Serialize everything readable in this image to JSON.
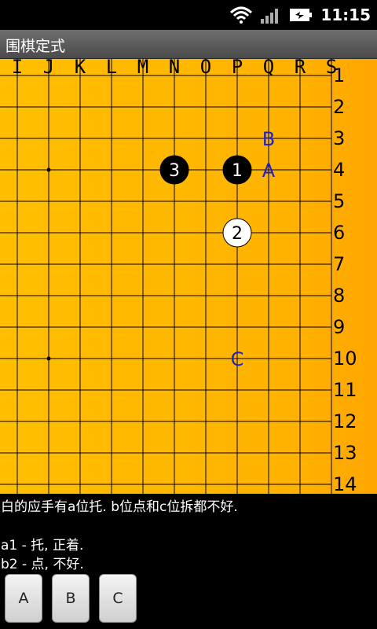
{
  "status_bar": {
    "time": "11:15"
  },
  "app": {
    "title": "围棋定式"
  },
  "board": {
    "col_labels": [
      "I",
      "J",
      "K",
      "L",
      "M",
      "N",
      "O",
      "P",
      "Q",
      "R",
      "S"
    ],
    "row_labels": [
      "1",
      "2",
      "3",
      "4",
      "5",
      "6",
      "7",
      "8",
      "9",
      "10",
      "11",
      "12",
      "13",
      "14"
    ],
    "star_points": [
      {
        "col": "J",
        "row": "4"
      },
      {
        "col": "J",
        "row": "10"
      }
    ],
    "stones": [
      {
        "color": "black",
        "col": "P",
        "row": "4",
        "number": "1"
      },
      {
        "color": "white",
        "col": "P",
        "row": "6",
        "number": "2"
      },
      {
        "color": "black",
        "col": "N",
        "row": "4",
        "number": "3"
      }
    ],
    "markers": [
      {
        "label": "A",
        "col": "Q",
        "row": "4"
      },
      {
        "label": "B",
        "col": "Q",
        "row": "3"
      },
      {
        "label": "C",
        "col": "P",
        "row": "10"
      }
    ]
  },
  "commentary": {
    "lines": [
      "白的应手有a位托. b位点和c位拆都不好.",
      "",
      "a1 - 托, 正着.",
      "b2 - 点, 不好."
    ]
  },
  "buttons": [
    {
      "label": "A"
    },
    {
      "label": "B"
    },
    {
      "label": "C"
    }
  ],
  "colors": {
    "board": "#ffb300",
    "marker_text": "#2222cc",
    "black_stone": "#000000",
    "white_stone": "#ffffff"
  }
}
